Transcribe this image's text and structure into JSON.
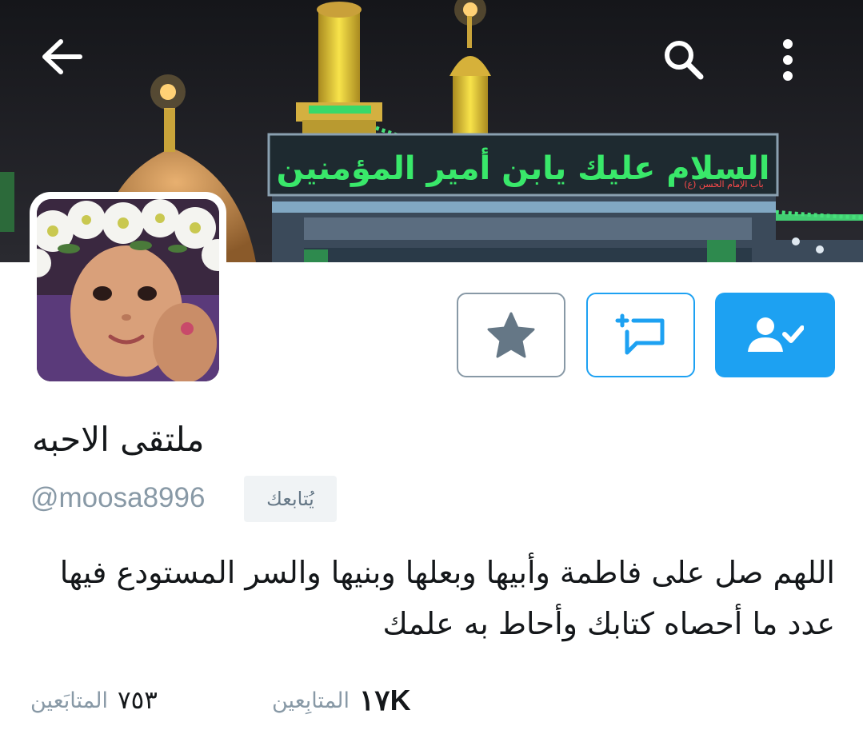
{
  "header": {
    "banner_sign_text": "السلام عليك يابن أمير المؤمنين",
    "banner_small_text": "باب الإمام الحسن (ع)"
  },
  "profile": {
    "name": "ملتقى الاحبه",
    "handle": "@moosa8996",
    "follows_you": "يُتابعك",
    "bio": "اللهم صل على فاطمة وأبيها وبعلها وبنيها والسر المستودع فيها عدد ما أحصاه كتابك وأحاط به علمك"
  },
  "stats": {
    "following_count": "٧٥٣",
    "following_label": "المتابَعين",
    "followers_count": "١٧K",
    "followers_label": "المتابِعين"
  },
  "colors": {
    "accent": "#1da1f2",
    "muted": "#8899a6",
    "text": "#14171a"
  },
  "icons": {
    "back": "arrow-left-icon",
    "search": "search-icon",
    "more": "more-vertical-icon",
    "favorite": "star-icon",
    "message": "new-message-icon",
    "following": "user-check-icon"
  }
}
